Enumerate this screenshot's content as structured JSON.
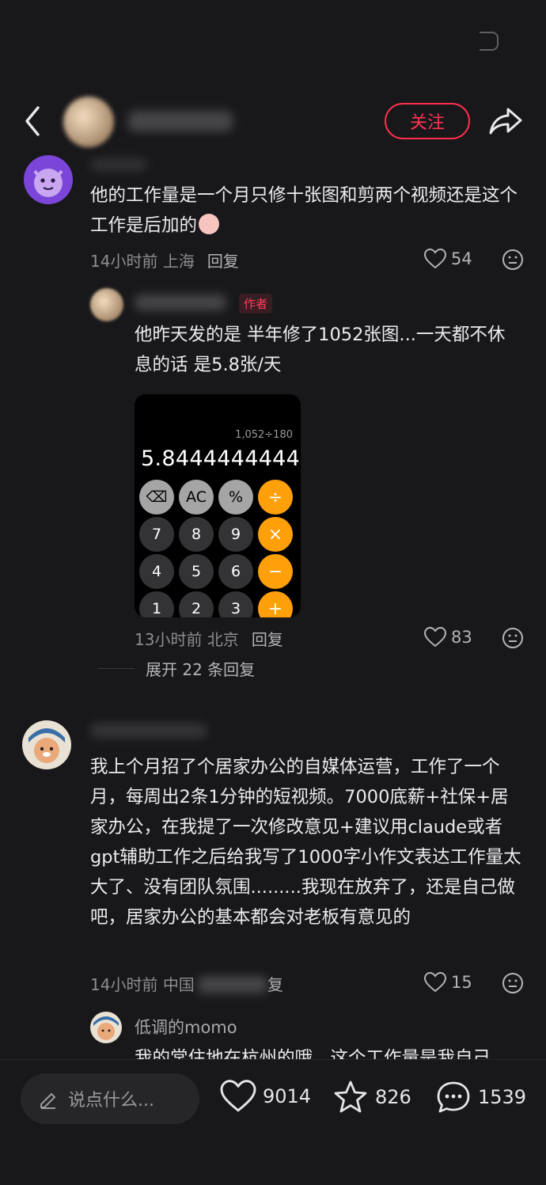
{
  "header": {
    "follow_label": "关注"
  },
  "comments": [
    {
      "text": "他的工作量是一个月只修十张图和剪两个视频还是这个工作是后加的",
      "time": "14小时前",
      "location": "上海",
      "reply_label": "回复",
      "likes": "54"
    },
    {
      "author_tag": "作者",
      "text": "他昨天发的是 半年修了1052张图...一天都不休息的话 是5.8张/天",
      "time": "13小时前",
      "location": "北京",
      "reply_label": "回复",
      "likes": "83",
      "image": {
        "expression": "1,052÷180",
        "result": "5.8444444444",
        "keys": [
          [
            "⌫",
            "AC",
            "%",
            "÷"
          ],
          [
            "7",
            "8",
            "9",
            "×"
          ],
          [
            "4",
            "5",
            "6",
            "−"
          ],
          [
            "1",
            "2",
            "3",
            "+"
          ]
        ]
      }
    },
    {
      "text": "我上个月招了个居家办公的自媒体运营，工作了一个月，每周出2条1分钟的短视频。7000底薪+社保+居家办公，在我提了一次修改意见+建议用claude或者gpt辅助工作之后给我写了1000字小作文表达工作量太大了、没有团队氛围.........我现在放弃了，还是自己做吧，居家办公的基本都会对老板有意见的",
      "time": "14小时前",
      "location": "中国",
      "reply_label_partial": "复",
      "likes": "15"
    },
    {
      "name": "低调的momo",
      "text_partial": "我的常住地在杭州的哦，这个工作量是我自己"
    }
  ],
  "expand_replies": "展开 22 条回复",
  "bottom": {
    "input_placeholder": "说点什么...",
    "likes": "9014",
    "favorites": "826",
    "comments": "1539"
  },
  "colors": {
    "background": "#18181a",
    "accent": "#ff2e4d",
    "calculator_operator": "#ff9f0a"
  },
  "icons": [
    "back-arrow-icon",
    "share-icon",
    "heart-icon",
    "emoji-icon",
    "pencil-icon",
    "star-icon",
    "chat-bubble-icon"
  ]
}
